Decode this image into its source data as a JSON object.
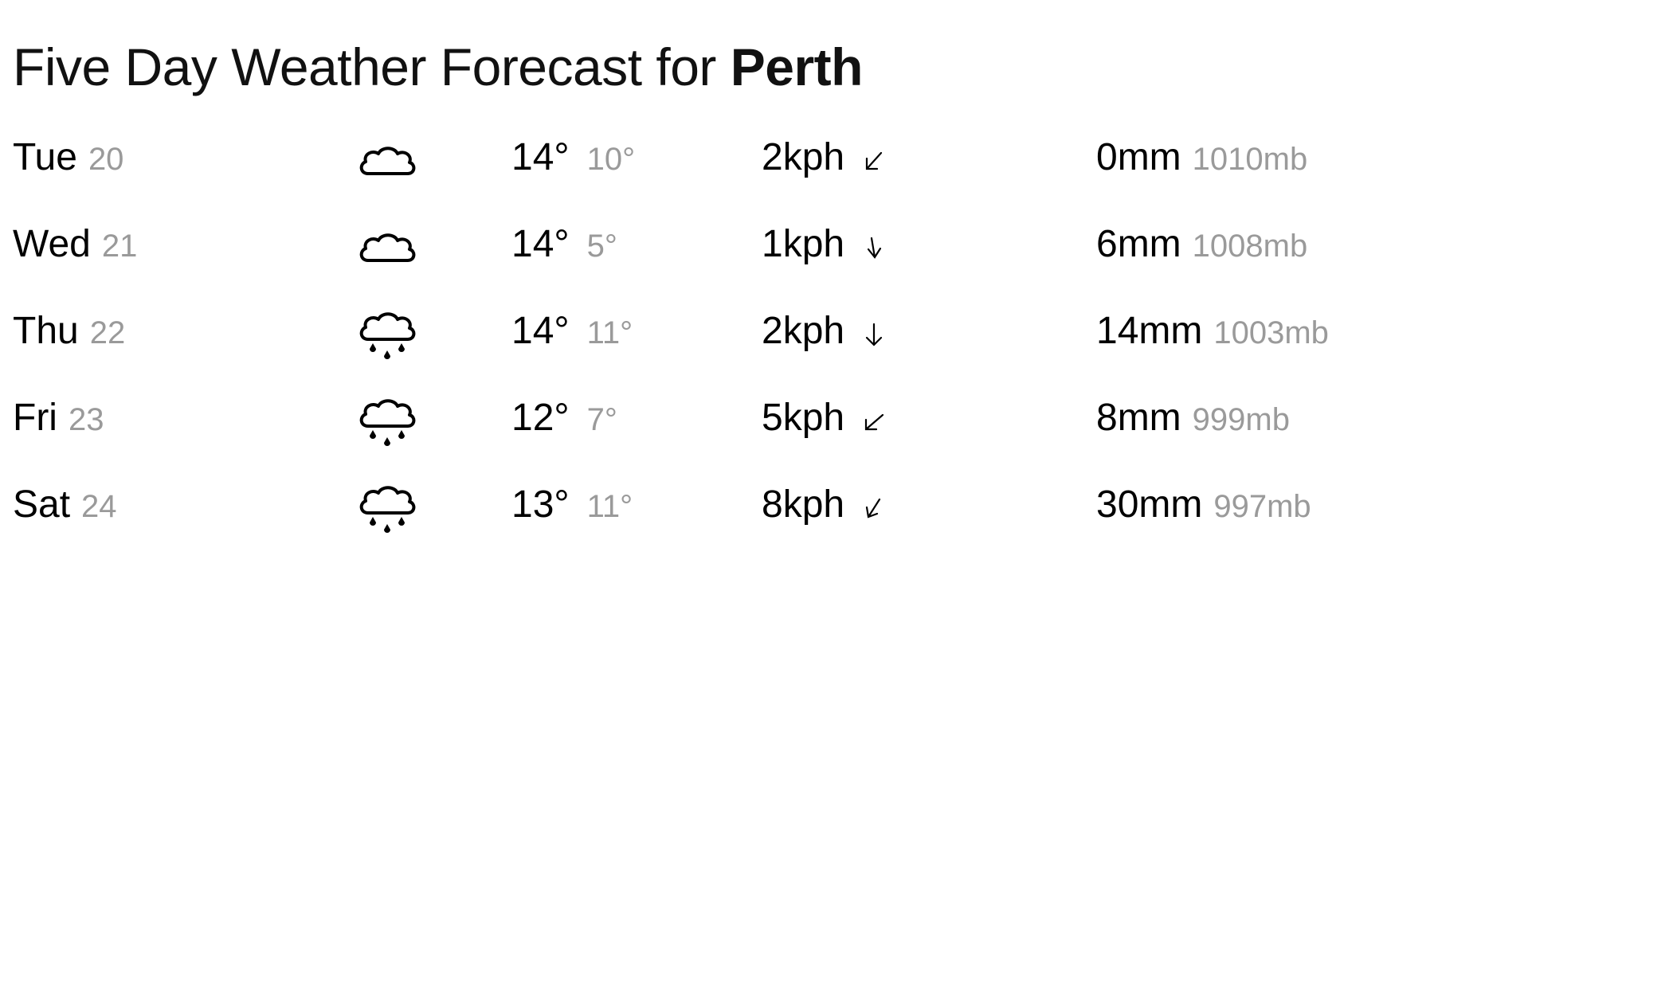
{
  "page": {
    "title_prefix": "Five Day Weather Forecast for",
    "city": "Perth"
  },
  "colors": {
    "primary_text": "#000000",
    "secondary_text": "#9a9a9a",
    "background": "#ffffff"
  },
  "days": [
    {
      "weekday": "Tue",
      "date": "20",
      "icon": "cloud-icon",
      "high": "14°",
      "low": "10°",
      "wind_speed": "2kph",
      "wind_arrow": "arrow-down-left-icon",
      "rain": "0mm",
      "pressure": "1010mb"
    },
    {
      "weekday": "Wed",
      "date": "21",
      "icon": "cloud-icon",
      "high": "14°",
      "low": "5°",
      "wind_speed": "1kph",
      "wind_arrow": "arrow-down-icon",
      "rain": "6mm",
      "pressure": "1008mb"
    },
    {
      "weekday": "Thu",
      "date": "22",
      "icon": "rain-cloud-icon",
      "high": "14°",
      "low": "11°",
      "wind_speed": "2kph",
      "wind_arrow": "arrow-down-icon",
      "rain": "14mm",
      "pressure": "1003mb"
    },
    {
      "weekday": "Fri",
      "date": "23",
      "icon": "rain-cloud-icon",
      "high": "12°",
      "low": "7°",
      "wind_speed": "5kph",
      "wind_arrow": "arrow-down-left-icon",
      "rain": "8mm",
      "pressure": "999mb"
    },
    {
      "weekday": "Sat",
      "date": "24",
      "icon": "rain-cloud-icon",
      "high": "13°",
      "low": "11°",
      "wind_speed": "8kph",
      "wind_arrow": "arrow-down-left-icon",
      "rain": "30mm",
      "pressure": "997mb"
    }
  ]
}
